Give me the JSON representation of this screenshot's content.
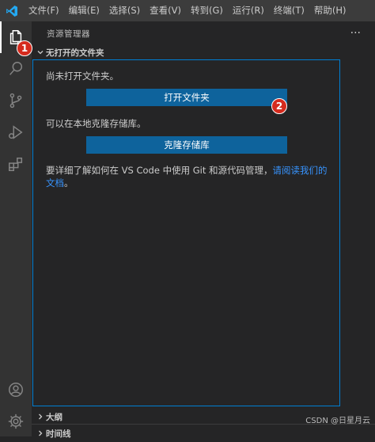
{
  "menubar": {
    "items": [
      "文件(F)",
      "编辑(E)",
      "选择(S)",
      "查看(V)",
      "转到(G)",
      "运行(R)",
      "终端(T)",
      "帮助(H)"
    ]
  },
  "activitybar": {
    "icons": [
      "explorer-icon",
      "search-icon",
      "source-control-icon",
      "run-debug-icon",
      "extensions-icon",
      "account-icon",
      "manage-gear-icon"
    ]
  },
  "sidebar": {
    "title": "资源管理器",
    "more": "···",
    "section_no_folder": "无打开的文件夹",
    "outline": "大纲",
    "timeline": "时间线"
  },
  "welcome": {
    "line1": "尚未打开文件夹。",
    "open_folder_button": "打开文件夹",
    "line2": "可以在本地克隆存储库。",
    "clone_button": "克隆存储库",
    "line3_prefix": "要详细了解如何在 VS Code 中使用 Git 和源代码管理，",
    "line3_link": "请阅读我们的文档",
    "line3_suffix": "。"
  },
  "annotations": {
    "badge1": "1",
    "badge2": "2",
    "badge_color": "#d52b1e"
  },
  "watermark": "CSDN @日星月云",
  "colors": {
    "accent": "#007fd4",
    "button": "#0e639c",
    "link": "#3794ff"
  }
}
